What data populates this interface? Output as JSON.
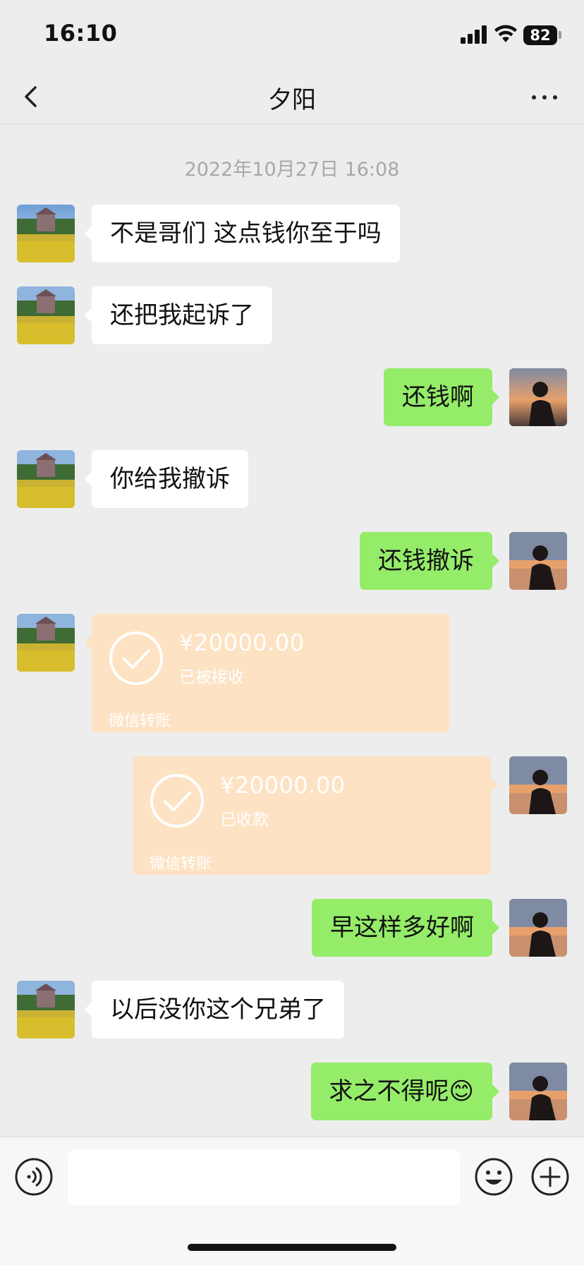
{
  "status_bar": {
    "time": "16:10",
    "battery": "82"
  },
  "header": {
    "title": "夕阳"
  },
  "timestamp": "2022年10月27日 16:08",
  "messages": [
    {
      "side": "left",
      "type": "text",
      "text": "不是哥们 这点钱你至于吗"
    },
    {
      "side": "left",
      "type": "text",
      "text": "还把我起诉了"
    },
    {
      "side": "right",
      "type": "text",
      "text": "还钱啊"
    },
    {
      "side": "left",
      "type": "text",
      "text": "你给我撤诉"
    },
    {
      "side": "right",
      "type": "text",
      "text": "还钱撤诉"
    },
    {
      "side": "left",
      "type": "transfer",
      "amount": "¥20000.00",
      "status": "已被接收",
      "label": "微信转账"
    },
    {
      "side": "right",
      "type": "transfer",
      "amount": "¥20000.00",
      "status": "已收款",
      "label": "微信转账"
    },
    {
      "side": "right",
      "type": "text",
      "text": "早这样多好啊"
    },
    {
      "side": "left",
      "type": "text",
      "text": "以后没你这个兄弟了"
    },
    {
      "side": "right",
      "type": "text",
      "text": "求之不得呢",
      "emoji": "😊"
    }
  ],
  "input_bar": {
    "placeholder": ""
  },
  "colors": {
    "left_bubble": "#ffffff",
    "right_bubble": "#95ec69",
    "transfer": "#fde2c3",
    "background": "#ededed"
  }
}
